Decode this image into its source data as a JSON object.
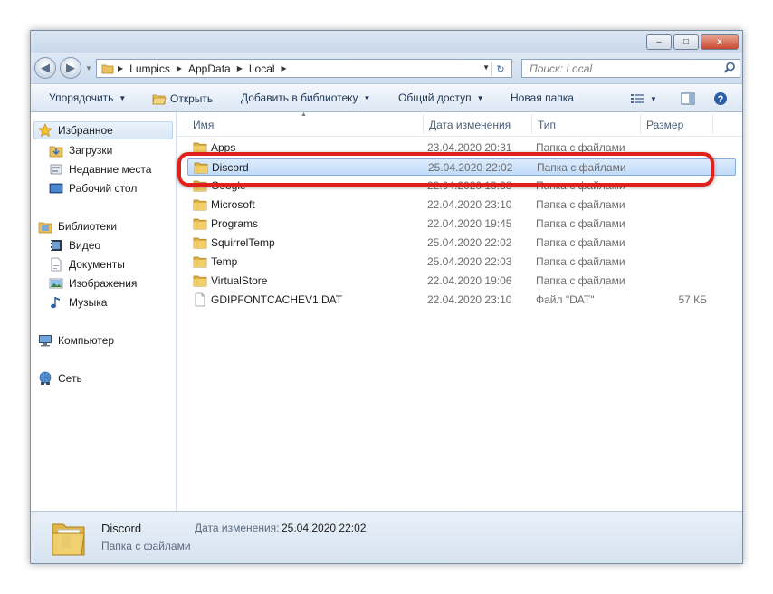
{
  "window": {
    "controls": {
      "minimize": "–",
      "maximize": "□",
      "close": "x"
    }
  },
  "address": {
    "crumbs": [
      "Lumpics",
      "AppData",
      "Local"
    ],
    "search_placeholder": "Поиск: Local"
  },
  "toolbar": {
    "organize": "Упорядочить",
    "open": "Открыть",
    "add_to_library": "Добавить в библиотеку",
    "share": "Общий доступ",
    "new_folder": "Новая папка"
  },
  "sidebar": {
    "favorites": "Избранное",
    "favorites_items": [
      "Загрузки",
      "Недавние места",
      "Рабочий стол"
    ],
    "libraries": "Библиотеки",
    "libraries_items": [
      "Видео",
      "Документы",
      "Изображения",
      "Музыка"
    ],
    "computer": "Компьютер",
    "network": "Сеть"
  },
  "columns": {
    "name": "Имя",
    "date": "Дата изменения",
    "type": "Тип",
    "size": "Размер"
  },
  "files": [
    {
      "name": "Apps",
      "date": "23.04.2020 20:31",
      "type": "Папка с файлами",
      "size": "",
      "kind": "folder"
    },
    {
      "name": "Discord",
      "date": "25.04.2020 22:02",
      "type": "Папка с файлами",
      "size": "",
      "kind": "folder"
    },
    {
      "name": "Google",
      "date": "22.04.2020 19:38",
      "type": "Папка с файлами",
      "size": "",
      "kind": "folder"
    },
    {
      "name": "Microsoft",
      "date": "22.04.2020 23:10",
      "type": "Папка с файлами",
      "size": "",
      "kind": "folder"
    },
    {
      "name": "Programs",
      "date": "22.04.2020 19:45",
      "type": "Папка с файлами",
      "size": "",
      "kind": "folder"
    },
    {
      "name": "SquirrelTemp",
      "date": "25.04.2020 22:02",
      "type": "Папка с файлами",
      "size": "",
      "kind": "folder"
    },
    {
      "name": "Temp",
      "date": "25.04.2020 22:03",
      "type": "Папка с файлами",
      "size": "",
      "kind": "folder"
    },
    {
      "name": "VirtualStore",
      "date": "22.04.2020 19:06",
      "type": "Папка с файлами",
      "size": "",
      "kind": "folder"
    },
    {
      "name": "GDIPFONTCACHEV1.DAT",
      "date": "22.04.2020 23:10",
      "type": "Файл \"DAT\"",
      "size": "57 КБ",
      "kind": "file"
    }
  ],
  "selected_index": 1,
  "details": {
    "name": "Discord",
    "type": "Папка с файлами",
    "date_label": "Дата изменения:",
    "date_value": "25.04.2020 22:02"
  },
  "colors": {
    "highlight": "#e0201a",
    "selection": "#c1dbfa",
    "folder": "#e8c15a"
  }
}
